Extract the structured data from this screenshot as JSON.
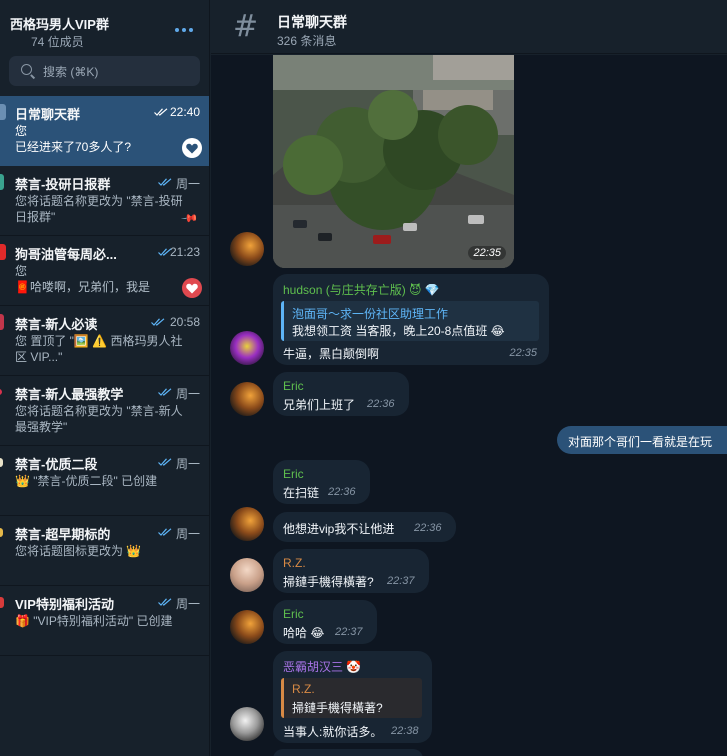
{
  "sidebar": {
    "group_name": "西格玛男人VIP群",
    "member_count": "74 位成员",
    "search_placeholder": "搜索 (⌘K)",
    "chats": [
      {
        "name": "日常聊天群",
        "time": "22:40",
        "line1": "您",
        "line2": "已经进来了70多人了?",
        "badge": "heart",
        "active": true
      },
      {
        "name": "禁言-投研日报群",
        "time": "周一",
        "preview": "您将话题名称更改为 \"禁言-投研日报群\"",
        "badge": "pin"
      },
      {
        "name": "狗哥油管每周必...",
        "time": "21:23",
        "line1": "您",
        "line2": "🧧哈喽啊，兄弟们，我是",
        "badge": "heart-red"
      },
      {
        "name": "禁言-新人必读",
        "time": "20:58",
        "preview": "您 置顶了 \"🖼️ ⚠️ 西格玛男人社区 VIP...\""
      },
      {
        "name": "禁言-新人最强教学",
        "time": "周一",
        "preview": "您将话题名称更改为 \"禁言-新人最强教学\""
      },
      {
        "name": "禁言-优质二段",
        "time": "周一",
        "preview": "👑 \"禁言-优质二段\" 已创建"
      },
      {
        "name": "禁言-超早期标的",
        "time": "周一",
        "preview": "您将话题图标更改为 👑"
      },
      {
        "name": "VIP特别福利活动",
        "time": "周一",
        "preview": "🎁 \"VIP特别福利活动\" 已创建"
      }
    ]
  },
  "chat": {
    "title": "日常聊天群",
    "subtitle": "326 条消息",
    "photo_time": "22:35",
    "messages": [
      {
        "sender": "hudson (与庄共存亡版) 😈 💎",
        "quote_title": "泡面哥～求一份社区助理工作",
        "quote_text": "我想领工资 当客服，晚上20-8点值班 😂",
        "text": "牛逼，黑白颠倒啊",
        "time": "22:35"
      },
      {
        "sender": "Eric",
        "text": "兄弟们上班了",
        "time": "22:36"
      },
      {
        "outgoing": true,
        "text": "对面那个哥们一看就是在玩"
      },
      {
        "sender": "Eric",
        "text": "在扫链",
        "time": "22:36"
      },
      {
        "text": "他想进vip我不让他进",
        "time": "22:36"
      },
      {
        "sender": "R.Z.",
        "text": "掃鏈手機得橫著?",
        "time": "22:37"
      },
      {
        "sender": "Eric",
        "text": "哈哈 😂",
        "time": "22:37"
      },
      {
        "sender": "恶霸胡汉三 🤡",
        "quote_title": "R.Z.",
        "quote_text": "掃鏈手機得橫著?",
        "text": "当事人:就你话多。",
        "time": "22:38"
      }
    ]
  },
  "colors": {
    "accent": "#5eb5f7",
    "eric": "#5fbf4e",
    "hudson": "#5fbf4e",
    "rz": "#d88a45",
    "hanzan": "#a974e8",
    "active_chat": "#2b5278"
  }
}
